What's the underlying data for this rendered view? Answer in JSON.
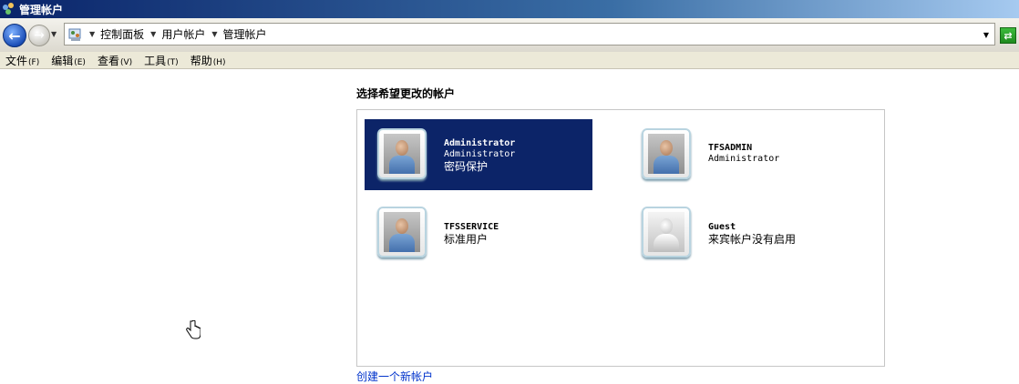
{
  "window": {
    "title": "管理帐户"
  },
  "address_bar": {
    "breadcrumbs": [
      "控制面板",
      "用户帐户",
      "管理帐户"
    ],
    "back_icon": "back-arrow-icon",
    "forward_icon": "forward-arrow-icon",
    "go_icon": "go-refresh-icon"
  },
  "menu": {
    "items": [
      {
        "label": "文件",
        "hotkey": "(F)"
      },
      {
        "label": "编辑",
        "hotkey": "(E)"
      },
      {
        "label": "查看",
        "hotkey": "(V)"
      },
      {
        "label": "工具",
        "hotkey": "(T)"
      },
      {
        "label": "帮助",
        "hotkey": "(H)"
      }
    ]
  },
  "main": {
    "heading": "选择希望更改的帐户",
    "accounts": [
      {
        "name": "Administrator",
        "type": "Administrator",
        "status": "密码保护",
        "selected": true
      },
      {
        "name": "TFSADMIN",
        "type": "Administrator",
        "status": "",
        "selected": false
      },
      {
        "name": "TFSSERVICE",
        "type": "",
        "status": "标准用户",
        "selected": false
      },
      {
        "name": "Guest",
        "type": "",
        "status": "来宾帐户没有启用",
        "selected": false
      }
    ],
    "create_link": "创建一个新帐户"
  },
  "colors": {
    "selected_background": "#0c2468",
    "link": "#0033cc",
    "title_bar": "#0a246a"
  }
}
